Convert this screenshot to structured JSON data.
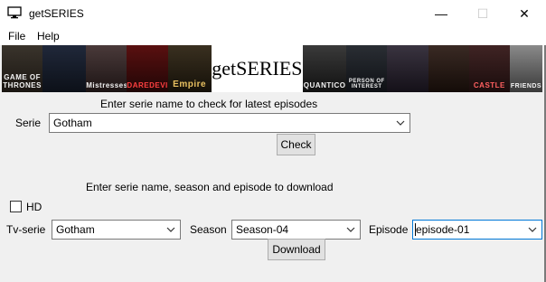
{
  "window": {
    "title": "getSERIES",
    "minimize_glyph": "—",
    "maximize_glyph": "☐",
    "close_glyph": "✕"
  },
  "menu": {
    "items": [
      "File",
      "Help"
    ]
  },
  "banner": {
    "logo_text": "getSERIES",
    "posters_left": [
      "GAME OF THRONES",
      "",
      "Mistresses",
      "DAREDEVIL",
      "Empire"
    ],
    "posters_right": [
      "QUANTICO",
      "PERSON OF INTEREST",
      "",
      "",
      "CASTLE",
      "FRIENDS"
    ]
  },
  "check_section": {
    "heading": "Enter serie name to check for latest episodes",
    "serie_label": "Serie",
    "serie_value": "Gotham",
    "check_button": "Check"
  },
  "download_section": {
    "heading": "Enter serie name, season and episode to download",
    "hd_label": "HD",
    "hd_checked": false,
    "tvserie_label": "Tv-serie",
    "tvserie_value": "Gotham",
    "season_label": "Season",
    "season_value": "Season-04",
    "episode_label": "Episode",
    "episode_value": "episode-01",
    "download_button": "Download"
  }
}
